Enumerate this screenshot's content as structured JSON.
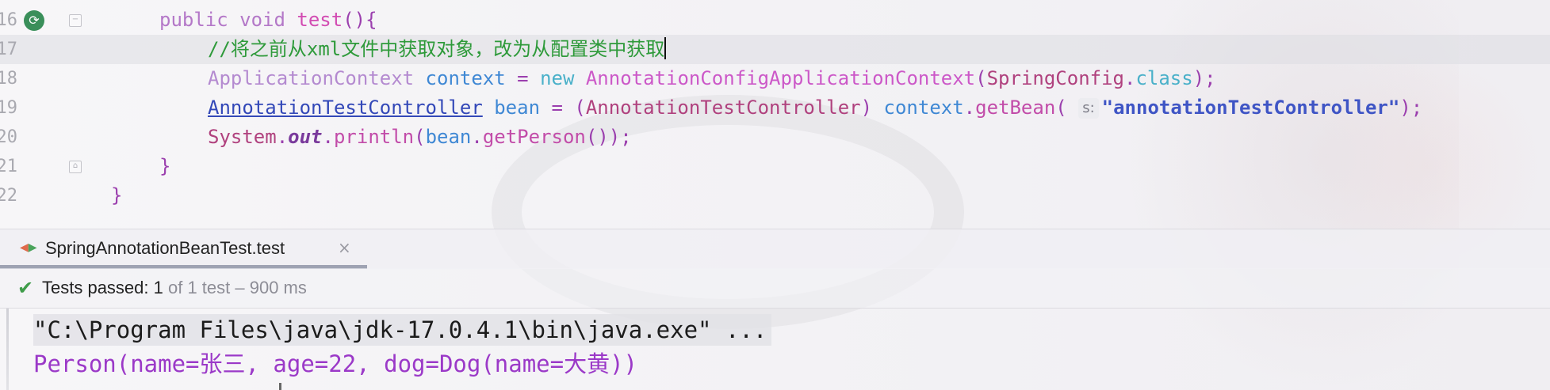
{
  "editor": {
    "lines": [
      {
        "num": "16",
        "indent": 1,
        "tokens": [
          {
            "t": "public void ",
            "c": "kw"
          },
          {
            "t": "test",
            "c": "fn"
          },
          {
            "t": "(){",
            "c": "punct"
          }
        ]
      },
      {
        "num": "17",
        "indent": 2,
        "current": true,
        "tokens": [
          {
            "t": "//",
            "c": "comment"
          },
          {
            "t": "将之前从",
            "c": "comment comment-cjk"
          },
          {
            "t": "xml",
            "c": "comment"
          },
          {
            "t": "文件中获取对象，改为从配置类中获取",
            "c": "comment comment-cjk"
          }
        ]
      },
      {
        "num": "18",
        "indent": 2,
        "tokens": [
          {
            "t": "ApplicationContext ",
            "c": "type-gray"
          },
          {
            "t": "context",
            "c": "var-blue"
          },
          {
            "t": " = ",
            "c": "punct"
          },
          {
            "t": "new ",
            "c": "class-kw"
          },
          {
            "t": "AnnotationConfigApplicationContext",
            "c": "cls-pink"
          },
          {
            "t": "(",
            "c": "punct"
          },
          {
            "t": "SpringConfig",
            "c": "cls-dark"
          },
          {
            "t": ".",
            "c": "punct"
          },
          {
            "t": "class",
            "c": "class-kw"
          },
          {
            "t": ");",
            "c": "punct"
          }
        ]
      },
      {
        "num": "19",
        "indent": 2,
        "tokens": [
          {
            "t": "AnnotationTestController",
            "c": "underlined"
          },
          {
            "t": " ",
            "c": "punct"
          },
          {
            "t": "bean",
            "c": "var-blue"
          },
          {
            "t": " = (",
            "c": "punct"
          },
          {
            "t": "AnnotationTestController",
            "c": "cls-dark"
          },
          {
            "t": ") ",
            "c": "punct"
          },
          {
            "t": "context",
            "c": "var-blue"
          },
          {
            "t": ".",
            "c": "punct"
          },
          {
            "t": "getBean",
            "c": "method"
          },
          {
            "t": "( ",
            "c": "punct"
          },
          {
            "t": "s:",
            "c": "hint"
          },
          {
            "t": "\"annotationTestController\"",
            "c": "string"
          },
          {
            "t": ");",
            "c": "punct"
          }
        ]
      },
      {
        "num": "20",
        "indent": 2,
        "tokens": [
          {
            "t": "System",
            "c": "cls-dark"
          },
          {
            "t": ".",
            "c": "punct"
          },
          {
            "t": "out",
            "c": "static-field"
          },
          {
            "t": ".",
            "c": "punct"
          },
          {
            "t": "println",
            "c": "method"
          },
          {
            "t": "(",
            "c": "punct"
          },
          {
            "t": "bean",
            "c": "var-blue"
          },
          {
            "t": ".",
            "c": "punct"
          },
          {
            "t": "getPerson",
            "c": "method"
          },
          {
            "t": "());",
            "c": "punct"
          }
        ]
      },
      {
        "num": "21",
        "indent": 1,
        "tokens": [
          {
            "t": "}",
            "c": "punct"
          }
        ]
      },
      {
        "num": "22",
        "indent": 0,
        "tokens": [
          {
            "t": "}",
            "c": "punct"
          }
        ]
      }
    ]
  },
  "run_window": {
    "tab_label": "SpringAnnotationBeanTest.test",
    "tab_close": "×",
    "status_label": "Tests passed: ",
    "status_count": "1",
    "status_detail": " of 1 test – 900 ms"
  },
  "console": {
    "command_line": "\"C:\\Program Files\\java\\jdk-17.0.4.1\\bin\\java.exe\" ...",
    "output_line": "Person(name=张三, age=22, dog=Dog(name=大黄))"
  }
}
